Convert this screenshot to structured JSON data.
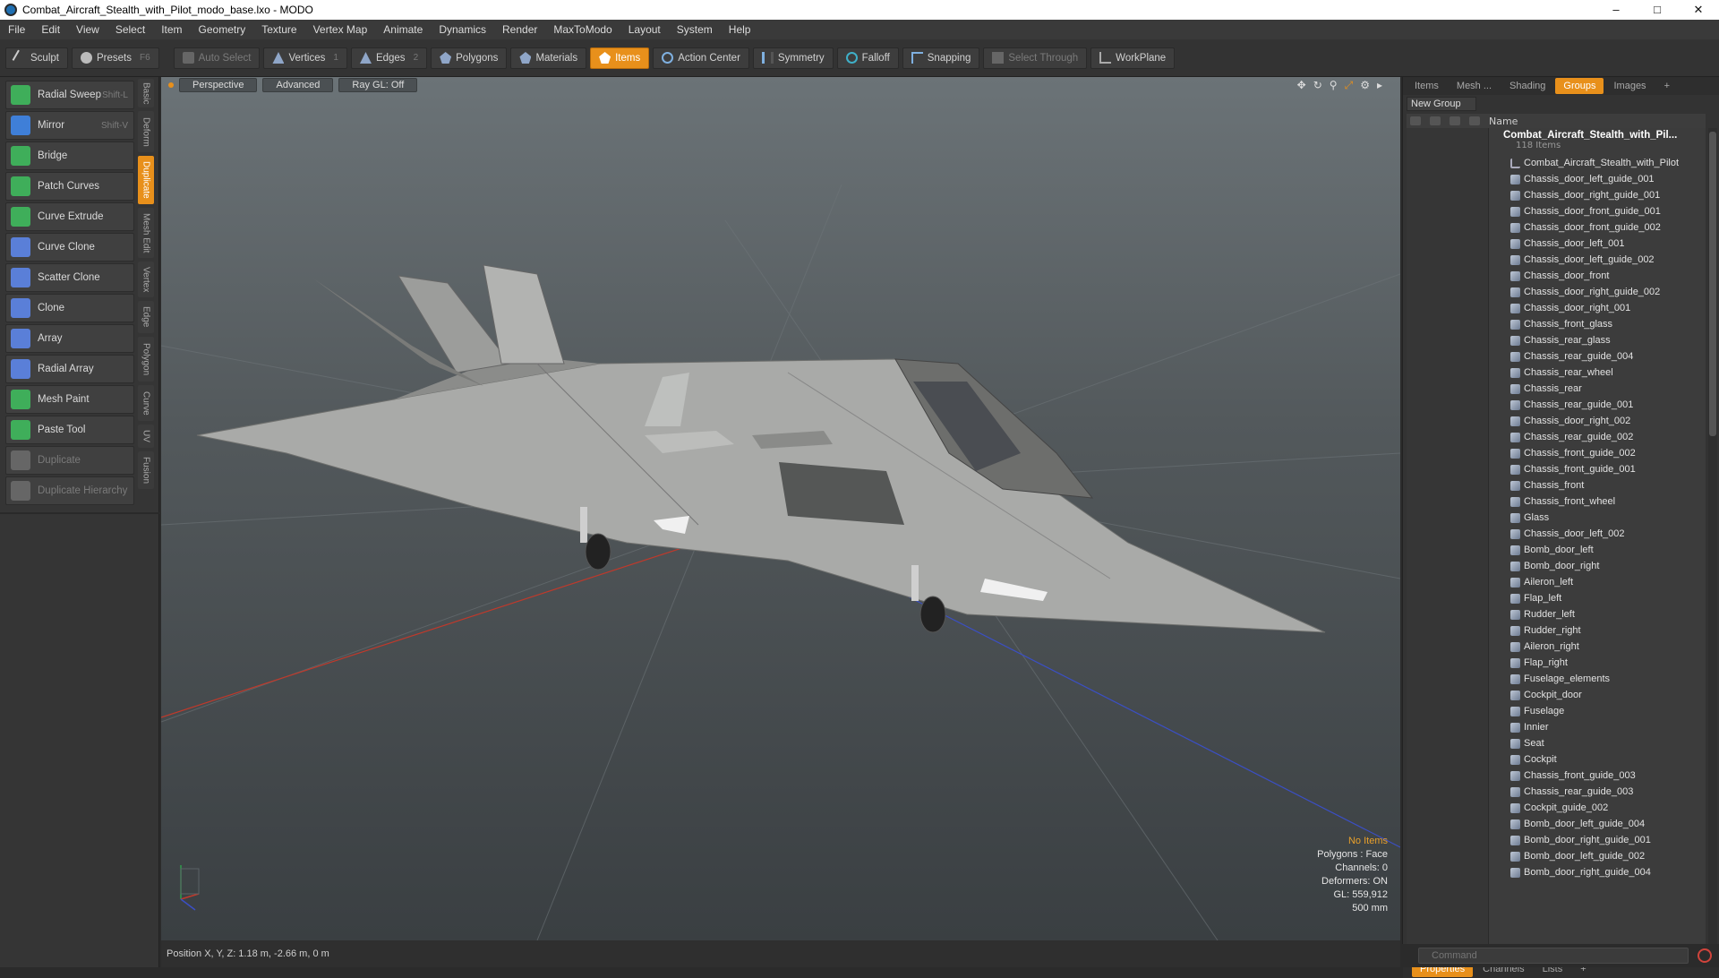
{
  "window": {
    "title": "Combat_Aircraft_Stealth_with_Pilot_modo_base.lxo - MODO",
    "controls": [
      "–",
      "□",
      "✕"
    ]
  },
  "menu": [
    "File",
    "Edit",
    "View",
    "Select",
    "Item",
    "Geometry",
    "Texture",
    "Vertex Map",
    "Animate",
    "Dynamics",
    "Render",
    "MaxToModo",
    "Layout",
    "System",
    "Help"
  ],
  "toolbar": {
    "sculpt": "Sculpt",
    "presets": "Presets",
    "presets_key": "F6",
    "auto_select": "Auto Select",
    "vertices": "Vertices",
    "vertices_num": "1",
    "edges": "Edges",
    "edges_num": "2",
    "polygons": "Polygons",
    "materials": "Materials",
    "items": "Items",
    "action_center": "Action Center",
    "symmetry": "Symmetry",
    "falloff": "Falloff",
    "snapping": "Snapping",
    "select_through": "Select Through",
    "workplane": "WorkPlane"
  },
  "tools": [
    {
      "label": "Radial Sweep",
      "shortcut": "Shift-L",
      "color": "#3fae5a"
    },
    {
      "label": "Mirror",
      "shortcut": "Shift-V",
      "color": "#3f7fd8"
    },
    {
      "label": "Bridge",
      "shortcut": "",
      "color": "#3fae5a"
    },
    {
      "label": "Patch Curves",
      "shortcut": "",
      "color": "#3fae5a"
    },
    {
      "label": "Curve Extrude",
      "shortcut": "",
      "color": "#3fae5a"
    },
    {
      "label": "Curve Clone",
      "shortcut": "",
      "color": "#5a7fd8"
    },
    {
      "label": "Scatter Clone",
      "shortcut": "",
      "color": "#5a7fd8"
    },
    {
      "label": "Clone",
      "shortcut": "",
      "color": "#5a7fd8"
    },
    {
      "label": "Array",
      "shortcut": "",
      "color": "#5a7fd8"
    },
    {
      "label": "Radial Array",
      "shortcut": "",
      "color": "#5a7fd8"
    },
    {
      "label": "Mesh Paint",
      "shortcut": "",
      "color": "#3fae5a"
    },
    {
      "label": "Paste Tool",
      "shortcut": "",
      "color": "#3fae5a"
    },
    {
      "label": "Duplicate",
      "shortcut": "",
      "color": "#666666"
    },
    {
      "label": "Duplicate Hierarchy",
      "shortcut": "",
      "color": "#666666"
    }
  ],
  "side_tabs": [
    "Basic",
    "Deform",
    "Duplicate",
    "Mesh Edit",
    "Vertex",
    "Edge",
    "Polygon",
    "Curve",
    "UV",
    "Fusion"
  ],
  "viewport": {
    "tabs": [
      "Perspective",
      "Advanced",
      "Ray GL: Off"
    ],
    "info": {
      "no_items": "No Items",
      "polygons": "Polygons : Face",
      "channels": "Channels: 0",
      "deformers": "Deformers: ON",
      "gl": "GL: 559,912",
      "scale": "500 mm"
    }
  },
  "status": "Position X, Y, Z:   1.18 m, -2.66 m, 0 m",
  "right_panel": {
    "tabs": [
      "Items",
      "Mesh ...",
      "Shading",
      "Groups",
      "Images",
      "+"
    ],
    "new_group": "New Group",
    "col_name": "Name",
    "root_name": "Combat_Aircraft_Stealth_with_Pil...",
    "root_count": "118 Items",
    "items": [
      "Combat_Aircraft_Stealth_with_Pilot",
      "Chassis_door_left_guide_001",
      "Chassis_door_right_guide_001",
      "Chassis_door_front_guide_001",
      "Chassis_door_front_guide_002",
      "Chassis_door_left_001",
      "Chassis_door_left_guide_002",
      "Chassis_door_front",
      "Chassis_door_right_guide_002",
      "Chassis_door_right_001",
      "Chassis_front_glass",
      "Chassis_rear_glass",
      "Chassis_rear_guide_004",
      "Chassis_rear_wheel",
      "Chassis_rear",
      "Chassis_rear_guide_001",
      "Chassis_door_right_002",
      "Chassis_rear_guide_002",
      "Chassis_front_guide_002",
      "Chassis_front_guide_001",
      "Chassis_front",
      "Chassis_front_wheel",
      "Glass",
      "Chassis_door_left_002",
      "Bomb_door_left",
      "Bomb_door_right",
      "Aileron_left",
      "Flap_left",
      "Rudder_left",
      "Rudder_right",
      "Aileron_right",
      "Flap_right",
      "Fuselage_elements",
      "Cockpit_door",
      "Fuselage",
      "Innier",
      "Seat",
      "Cockpit",
      "Chassis_front_guide_003",
      "Chassis_rear_guide_003",
      "Cockpit_guide_002",
      "Bomb_door_left_guide_004",
      "Bomb_door_right_guide_001",
      "Bomb_door_left_guide_002",
      "Bomb_door_right_guide_004"
    ],
    "bottom_tabs": [
      "Properties",
      "Channels",
      "Lists",
      "+"
    ],
    "command_placeholder": "Command"
  },
  "colors": {
    "accent": "#e8901b",
    "x_axis": "#c0392b",
    "z_axis": "#3b4fc4"
  }
}
